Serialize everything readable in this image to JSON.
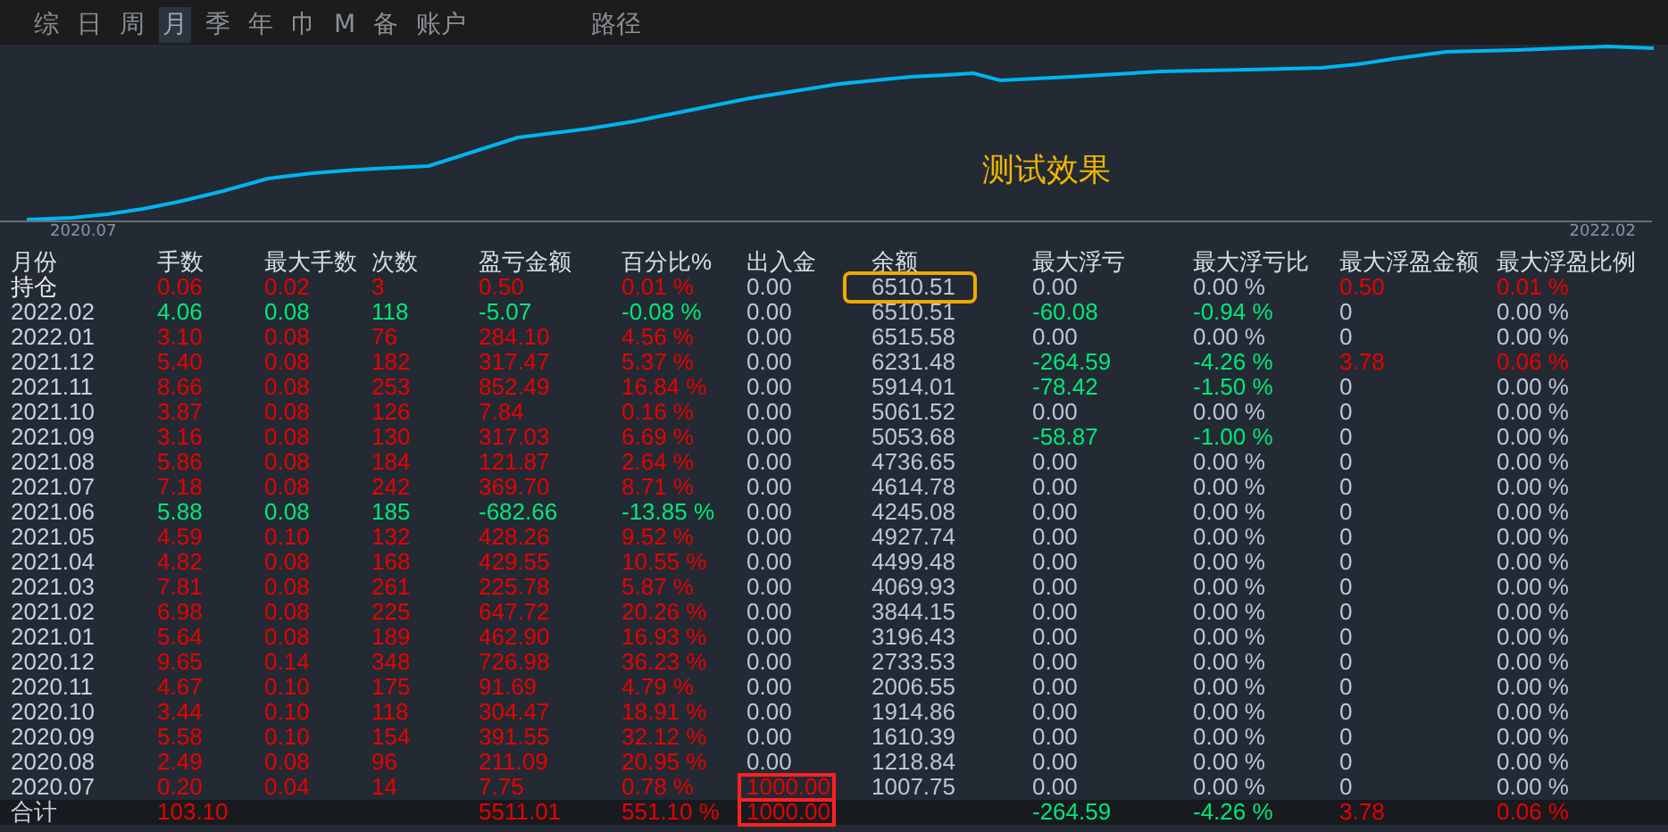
{
  "tabs": [
    {
      "label": "综",
      "selected": false
    },
    {
      "label": "日",
      "selected": false
    },
    {
      "label": "周",
      "selected": false
    },
    {
      "label": "月",
      "selected": true
    },
    {
      "label": "季",
      "selected": false
    },
    {
      "label": "年",
      "selected": false
    },
    {
      "label": "巾",
      "selected": false
    },
    {
      "label": "M",
      "selected": false
    },
    {
      "label": "备",
      "selected": false
    },
    {
      "label": "账户",
      "selected": false
    },
    {
      "label": "路径",
      "selected": false
    }
  ],
  "chart": {
    "start_label": "2020.07",
    "end_label": "2022.02",
    "caption": "测试效果"
  },
  "table": {
    "columns": [
      "月份",
      "手数",
      "最大手数",
      "次数",
      "盈亏金额",
      "百分比%",
      "出入金",
      "余额",
      "最大浮亏",
      "最大浮亏比",
      "最大浮盈金额",
      "最大浮盈比例"
    ],
    "rows": [
      {
        "kind": "holding",
        "cells": [
          {
            "text": "持仓",
            "kind": "label"
          },
          {
            "text": "0.06",
            "kind": "up"
          },
          {
            "text": "0.02",
            "kind": "up"
          },
          {
            "text": "3",
            "kind": "up"
          },
          {
            "text": "0.50",
            "kind": "up"
          },
          {
            "text": "0.01 %",
            "kind": "up"
          },
          {
            "text": "0.00",
            "kind": "flat"
          },
          {
            "text": "6510.51",
            "kind": "flat",
            "boxed": true
          },
          {
            "text": "0.00",
            "kind": "flat"
          },
          {
            "text": "0.00 %",
            "kind": "flat"
          },
          {
            "text": "0.50",
            "kind": "up"
          },
          {
            "text": "0.01 %",
            "kind": "up"
          }
        ]
      },
      {
        "kind": "month",
        "cells": [
          {
            "text": "2022.02",
            "kind": "label"
          },
          {
            "text": "4.06",
            "kind": "down"
          },
          {
            "text": "0.08",
            "kind": "down"
          },
          {
            "text": "118",
            "kind": "down"
          },
          {
            "text": "-5.07",
            "kind": "down"
          },
          {
            "text": "-0.08 %",
            "kind": "down"
          },
          {
            "text": "0.00",
            "kind": "flat"
          },
          {
            "text": "6510.51",
            "kind": "flat"
          },
          {
            "text": "-60.08",
            "kind": "down"
          },
          {
            "text": "-0.94 %",
            "kind": "down"
          },
          {
            "text": "0",
            "kind": "flat"
          },
          {
            "text": "0.00 %",
            "kind": "flat"
          }
        ]
      },
      {
        "kind": "month",
        "cells": [
          {
            "text": "2022.01",
            "kind": "label"
          },
          {
            "text": "3.10",
            "kind": "up"
          },
          {
            "text": "0.08",
            "kind": "up"
          },
          {
            "text": "76",
            "kind": "up"
          },
          {
            "text": "284.10",
            "kind": "up"
          },
          {
            "text": "4.56 %",
            "kind": "up"
          },
          {
            "text": "0.00",
            "kind": "flat"
          },
          {
            "text": "6515.58",
            "kind": "flat"
          },
          {
            "text": "0.00",
            "kind": "flat"
          },
          {
            "text": "0.00 %",
            "kind": "flat"
          },
          {
            "text": "0",
            "kind": "flat"
          },
          {
            "text": "0.00 %",
            "kind": "flat"
          }
        ]
      },
      {
        "kind": "month",
        "cells": [
          {
            "text": "2021.12",
            "kind": "label"
          },
          {
            "text": "5.40",
            "kind": "up"
          },
          {
            "text": "0.08",
            "kind": "up"
          },
          {
            "text": "182",
            "kind": "up"
          },
          {
            "text": "317.47",
            "kind": "up"
          },
          {
            "text": "5.37 %",
            "kind": "up"
          },
          {
            "text": "0.00",
            "kind": "flat"
          },
          {
            "text": "6231.48",
            "kind": "flat"
          },
          {
            "text": "-264.59",
            "kind": "down"
          },
          {
            "text": "-4.26 %",
            "kind": "down"
          },
          {
            "text": "3.78",
            "kind": "up"
          },
          {
            "text": "0.06 %",
            "kind": "up"
          }
        ]
      },
      {
        "kind": "month",
        "cells": [
          {
            "text": "2021.11",
            "kind": "label"
          },
          {
            "text": "8.66",
            "kind": "up"
          },
          {
            "text": "0.08",
            "kind": "up"
          },
          {
            "text": "253",
            "kind": "up"
          },
          {
            "text": "852.49",
            "kind": "up"
          },
          {
            "text": "16.84 %",
            "kind": "up"
          },
          {
            "text": "0.00",
            "kind": "flat"
          },
          {
            "text": "5914.01",
            "kind": "flat"
          },
          {
            "text": "-78.42",
            "kind": "down"
          },
          {
            "text": "-1.50 %",
            "kind": "down"
          },
          {
            "text": "0",
            "kind": "flat"
          },
          {
            "text": "0.00 %",
            "kind": "flat"
          }
        ]
      },
      {
        "kind": "month",
        "cells": [
          {
            "text": "2021.10",
            "kind": "label"
          },
          {
            "text": "3.87",
            "kind": "up"
          },
          {
            "text": "0.08",
            "kind": "up"
          },
          {
            "text": "126",
            "kind": "up"
          },
          {
            "text": "7.84",
            "kind": "up"
          },
          {
            "text": "0.16 %",
            "kind": "up"
          },
          {
            "text": "0.00",
            "kind": "flat"
          },
          {
            "text": "5061.52",
            "kind": "flat"
          },
          {
            "text": "0.00",
            "kind": "flat"
          },
          {
            "text": "0.00 %",
            "kind": "flat"
          },
          {
            "text": "0",
            "kind": "flat"
          },
          {
            "text": "0.00 %",
            "kind": "flat"
          }
        ]
      },
      {
        "kind": "month",
        "cells": [
          {
            "text": "2021.09",
            "kind": "label"
          },
          {
            "text": "3.16",
            "kind": "up"
          },
          {
            "text": "0.08",
            "kind": "up"
          },
          {
            "text": "130",
            "kind": "up"
          },
          {
            "text": "317.03",
            "kind": "up"
          },
          {
            "text": "6.69 %",
            "kind": "up"
          },
          {
            "text": "0.00",
            "kind": "flat"
          },
          {
            "text": "5053.68",
            "kind": "flat"
          },
          {
            "text": "-58.87",
            "kind": "down"
          },
          {
            "text": "-1.00 %",
            "kind": "down"
          },
          {
            "text": "0",
            "kind": "flat"
          },
          {
            "text": "0.00 %",
            "kind": "flat"
          }
        ]
      },
      {
        "kind": "month",
        "cells": [
          {
            "text": "2021.08",
            "kind": "label"
          },
          {
            "text": "5.86",
            "kind": "up"
          },
          {
            "text": "0.08",
            "kind": "up"
          },
          {
            "text": "184",
            "kind": "up"
          },
          {
            "text": "121.87",
            "kind": "up"
          },
          {
            "text": "2.64 %",
            "kind": "up"
          },
          {
            "text": "0.00",
            "kind": "flat"
          },
          {
            "text": "4736.65",
            "kind": "flat"
          },
          {
            "text": "0.00",
            "kind": "flat"
          },
          {
            "text": "0.00 %",
            "kind": "flat"
          },
          {
            "text": "0",
            "kind": "flat"
          },
          {
            "text": "0.00 %",
            "kind": "flat"
          }
        ]
      },
      {
        "kind": "month",
        "cells": [
          {
            "text": "2021.07",
            "kind": "label"
          },
          {
            "text": "7.18",
            "kind": "up"
          },
          {
            "text": "0.08",
            "kind": "up"
          },
          {
            "text": "242",
            "kind": "up"
          },
          {
            "text": "369.70",
            "kind": "up"
          },
          {
            "text": "8.71 %",
            "kind": "up"
          },
          {
            "text": "0.00",
            "kind": "flat"
          },
          {
            "text": "4614.78",
            "kind": "flat"
          },
          {
            "text": "0.00",
            "kind": "flat"
          },
          {
            "text": "0.00 %",
            "kind": "flat"
          },
          {
            "text": "0",
            "kind": "flat"
          },
          {
            "text": "0.00 %",
            "kind": "flat"
          }
        ]
      },
      {
        "kind": "month",
        "cells": [
          {
            "text": "2021.06",
            "kind": "label"
          },
          {
            "text": "5.88",
            "kind": "down"
          },
          {
            "text": "0.08",
            "kind": "down"
          },
          {
            "text": "185",
            "kind": "down"
          },
          {
            "text": "-682.66",
            "kind": "down"
          },
          {
            "text": "-13.85 %",
            "kind": "down"
          },
          {
            "text": "0.00",
            "kind": "flat"
          },
          {
            "text": "4245.08",
            "kind": "flat"
          },
          {
            "text": "0.00",
            "kind": "flat"
          },
          {
            "text": "0.00 %",
            "kind": "flat"
          },
          {
            "text": "0",
            "kind": "flat"
          },
          {
            "text": "0.00 %",
            "kind": "flat"
          }
        ]
      },
      {
        "kind": "month",
        "cells": [
          {
            "text": "2021.05",
            "kind": "label"
          },
          {
            "text": "4.59",
            "kind": "up"
          },
          {
            "text": "0.10",
            "kind": "up"
          },
          {
            "text": "132",
            "kind": "up"
          },
          {
            "text": "428.26",
            "kind": "up"
          },
          {
            "text": "9.52 %",
            "kind": "up"
          },
          {
            "text": "0.00",
            "kind": "flat"
          },
          {
            "text": "4927.74",
            "kind": "flat"
          },
          {
            "text": "0.00",
            "kind": "flat"
          },
          {
            "text": "0.00 %",
            "kind": "flat"
          },
          {
            "text": "0",
            "kind": "flat"
          },
          {
            "text": "0.00 %",
            "kind": "flat"
          }
        ]
      },
      {
        "kind": "month",
        "cells": [
          {
            "text": "2021.04",
            "kind": "label"
          },
          {
            "text": "4.82",
            "kind": "up"
          },
          {
            "text": "0.08",
            "kind": "up"
          },
          {
            "text": "168",
            "kind": "up"
          },
          {
            "text": "429.55",
            "kind": "up"
          },
          {
            "text": "10.55 %",
            "kind": "up"
          },
          {
            "text": "0.00",
            "kind": "flat"
          },
          {
            "text": "4499.48",
            "kind": "flat"
          },
          {
            "text": "0.00",
            "kind": "flat"
          },
          {
            "text": "0.00 %",
            "kind": "flat"
          },
          {
            "text": "0",
            "kind": "flat"
          },
          {
            "text": "0.00 %",
            "kind": "flat"
          }
        ]
      },
      {
        "kind": "month",
        "cells": [
          {
            "text": "2021.03",
            "kind": "label"
          },
          {
            "text": "7.81",
            "kind": "up"
          },
          {
            "text": "0.08",
            "kind": "up"
          },
          {
            "text": "261",
            "kind": "up"
          },
          {
            "text": "225.78",
            "kind": "up"
          },
          {
            "text": "5.87 %",
            "kind": "up"
          },
          {
            "text": "0.00",
            "kind": "flat"
          },
          {
            "text": "4069.93",
            "kind": "flat"
          },
          {
            "text": "0.00",
            "kind": "flat"
          },
          {
            "text": "0.00 %",
            "kind": "flat"
          },
          {
            "text": "0",
            "kind": "flat"
          },
          {
            "text": "0.00 %",
            "kind": "flat"
          }
        ]
      },
      {
        "kind": "month",
        "cells": [
          {
            "text": "2021.02",
            "kind": "label"
          },
          {
            "text": "6.98",
            "kind": "up"
          },
          {
            "text": "0.08",
            "kind": "up"
          },
          {
            "text": "225",
            "kind": "up"
          },
          {
            "text": "647.72",
            "kind": "up"
          },
          {
            "text": "20.26 %",
            "kind": "up"
          },
          {
            "text": "0.00",
            "kind": "flat"
          },
          {
            "text": "3844.15",
            "kind": "flat"
          },
          {
            "text": "0.00",
            "kind": "flat"
          },
          {
            "text": "0.00 %",
            "kind": "flat"
          },
          {
            "text": "0",
            "kind": "flat"
          },
          {
            "text": "0.00 %",
            "kind": "flat"
          }
        ]
      },
      {
        "kind": "month",
        "cells": [
          {
            "text": "2021.01",
            "kind": "label"
          },
          {
            "text": "5.64",
            "kind": "up"
          },
          {
            "text": "0.08",
            "kind": "up"
          },
          {
            "text": "189",
            "kind": "up"
          },
          {
            "text": "462.90",
            "kind": "up"
          },
          {
            "text": "16.93 %",
            "kind": "up"
          },
          {
            "text": "0.00",
            "kind": "flat"
          },
          {
            "text": "3196.43",
            "kind": "flat"
          },
          {
            "text": "0.00",
            "kind": "flat"
          },
          {
            "text": "0.00 %",
            "kind": "flat"
          },
          {
            "text": "0",
            "kind": "flat"
          },
          {
            "text": "0.00 %",
            "kind": "flat"
          }
        ]
      },
      {
        "kind": "month",
        "cells": [
          {
            "text": "2020.12",
            "kind": "label"
          },
          {
            "text": "9.65",
            "kind": "up"
          },
          {
            "text": "0.14",
            "kind": "up"
          },
          {
            "text": "348",
            "kind": "up"
          },
          {
            "text": "726.98",
            "kind": "up"
          },
          {
            "text": "36.23 %",
            "kind": "up"
          },
          {
            "text": "0.00",
            "kind": "flat"
          },
          {
            "text": "2733.53",
            "kind": "flat"
          },
          {
            "text": "0.00",
            "kind": "flat"
          },
          {
            "text": "0.00 %",
            "kind": "flat"
          },
          {
            "text": "0",
            "kind": "flat"
          },
          {
            "text": "0.00 %",
            "kind": "flat"
          }
        ]
      },
      {
        "kind": "month",
        "cells": [
          {
            "text": "2020.11",
            "kind": "label"
          },
          {
            "text": "4.67",
            "kind": "up"
          },
          {
            "text": "0.10",
            "kind": "up"
          },
          {
            "text": "175",
            "kind": "up"
          },
          {
            "text": "91.69",
            "kind": "up"
          },
          {
            "text": "4.79 %",
            "kind": "up"
          },
          {
            "text": "0.00",
            "kind": "flat"
          },
          {
            "text": "2006.55",
            "kind": "flat"
          },
          {
            "text": "0.00",
            "kind": "flat"
          },
          {
            "text": "0.00 %",
            "kind": "flat"
          },
          {
            "text": "0",
            "kind": "flat"
          },
          {
            "text": "0.00 %",
            "kind": "flat"
          }
        ]
      },
      {
        "kind": "month",
        "cells": [
          {
            "text": "2020.10",
            "kind": "label"
          },
          {
            "text": "3.44",
            "kind": "up"
          },
          {
            "text": "0.10",
            "kind": "up"
          },
          {
            "text": "118",
            "kind": "up"
          },
          {
            "text": "304.47",
            "kind": "up"
          },
          {
            "text": "18.91 %",
            "kind": "up"
          },
          {
            "text": "0.00",
            "kind": "flat"
          },
          {
            "text": "1914.86",
            "kind": "flat"
          },
          {
            "text": "0.00",
            "kind": "flat"
          },
          {
            "text": "0.00 %",
            "kind": "flat"
          },
          {
            "text": "0",
            "kind": "flat"
          },
          {
            "text": "0.00 %",
            "kind": "flat"
          }
        ]
      },
      {
        "kind": "month",
        "cells": [
          {
            "text": "2020.09",
            "kind": "label"
          },
          {
            "text": "5.58",
            "kind": "up"
          },
          {
            "text": "0.10",
            "kind": "up"
          },
          {
            "text": "154",
            "kind": "up"
          },
          {
            "text": "391.55",
            "kind": "up"
          },
          {
            "text": "32.12 %",
            "kind": "up"
          },
          {
            "text": "0.00",
            "kind": "flat"
          },
          {
            "text": "1610.39",
            "kind": "flat"
          },
          {
            "text": "0.00",
            "kind": "flat"
          },
          {
            "text": "0.00 %",
            "kind": "flat"
          },
          {
            "text": "0",
            "kind": "flat"
          },
          {
            "text": "0.00 %",
            "kind": "flat"
          }
        ]
      },
      {
        "kind": "month",
        "cells": [
          {
            "text": "2020.08",
            "kind": "label"
          },
          {
            "text": "2.49",
            "kind": "up"
          },
          {
            "text": "0.08",
            "kind": "up"
          },
          {
            "text": "96",
            "kind": "up"
          },
          {
            "text": "211.09",
            "kind": "up"
          },
          {
            "text": "20.95 %",
            "kind": "up"
          },
          {
            "text": "0.00",
            "kind": "flat"
          },
          {
            "text": "1218.84",
            "kind": "flat"
          },
          {
            "text": "0.00",
            "kind": "flat"
          },
          {
            "text": "0.00 %",
            "kind": "flat"
          },
          {
            "text": "0",
            "kind": "flat"
          },
          {
            "text": "0.00 %",
            "kind": "flat"
          }
        ]
      },
      {
        "kind": "month",
        "cells": [
          {
            "text": "2020.07",
            "kind": "label"
          },
          {
            "text": "0.20",
            "kind": "up"
          },
          {
            "text": "0.04",
            "kind": "up"
          },
          {
            "text": "14",
            "kind": "up"
          },
          {
            "text": "7.75",
            "kind": "up"
          },
          {
            "text": "0.78 %",
            "kind": "up"
          },
          {
            "text": "1000.00",
            "kind": "up",
            "boxed": true
          },
          {
            "text": "1007.75",
            "kind": "flat"
          },
          {
            "text": "0.00",
            "kind": "flat"
          },
          {
            "text": "0.00 %",
            "kind": "flat"
          },
          {
            "text": "0",
            "kind": "flat"
          },
          {
            "text": "0.00 %",
            "kind": "flat"
          }
        ]
      },
      {
        "kind": "total",
        "cells": [
          {
            "text": "合计",
            "kind": "label"
          },
          {
            "text": "103.10",
            "kind": "up"
          },
          null,
          null,
          {
            "text": "5511.01",
            "kind": "up"
          },
          {
            "text": "551.10 %",
            "kind": "up"
          },
          {
            "text": "1000.00",
            "kind": "up",
            "boxed": true
          },
          null,
          {
            "text": "-264.59",
            "kind": "down"
          },
          {
            "text": "-4.26 %",
            "kind": "down"
          },
          {
            "text": "3.78",
            "kind": "up"
          },
          {
            "text": "0.06 %",
            "kind": "up"
          }
        ]
      }
    ]
  }
}
